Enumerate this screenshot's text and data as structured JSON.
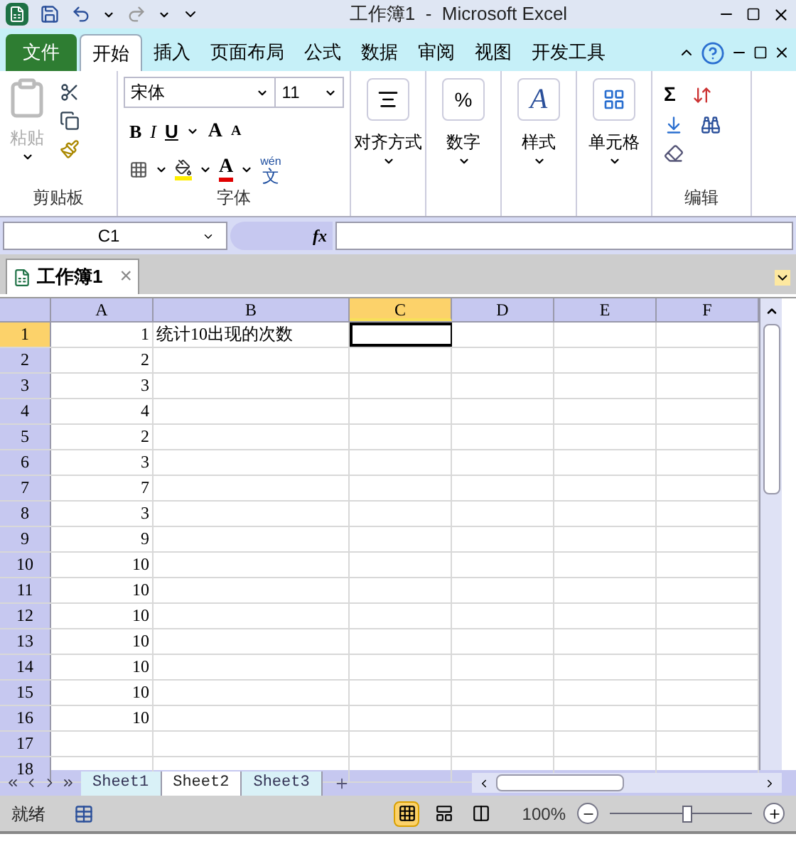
{
  "window": {
    "title": "工作簿1  -  Microsoft Excel"
  },
  "ribbon_tabs": [
    {
      "label": "文件",
      "kind": "file",
      "selected": false
    },
    {
      "label": "开始",
      "kind": "tab",
      "selected": true
    },
    {
      "label": "插入",
      "kind": "tab",
      "selected": false
    },
    {
      "label": "页面布局",
      "kind": "tab",
      "selected": false
    },
    {
      "label": "公式",
      "kind": "tab",
      "selected": false
    },
    {
      "label": "数据",
      "kind": "tab",
      "selected": false
    },
    {
      "label": "审阅",
      "kind": "tab",
      "selected": false
    },
    {
      "label": "视图",
      "kind": "tab",
      "selected": false
    },
    {
      "label": "开发工具",
      "kind": "tab",
      "selected": false
    }
  ],
  "clipboard": {
    "paste": "粘贴",
    "group": "剪贴板"
  },
  "font": {
    "name": "宋体",
    "size": "11",
    "bold": "B",
    "italic": "I",
    "underline": "U",
    "grow": "A",
    "shrink": "A",
    "font_color": "A",
    "phonetic_top": "wén",
    "phonetic_bottom": "文",
    "group": "字体"
  },
  "big_buttons": [
    {
      "label": "对齐方式",
      "kind": "align"
    },
    {
      "label": "数字",
      "kind": "number",
      "glyph": "%"
    },
    {
      "label": "样式",
      "kind": "styles",
      "glyph": "A"
    },
    {
      "label": "单元格",
      "kind": "cells"
    }
  ],
  "editing": {
    "sum": "Σ",
    "group": "编辑"
  },
  "formula_bar": {
    "name_box": "C1",
    "fx": "fx"
  },
  "workbook_tab": {
    "title": "工作簿1",
    "close": "×"
  },
  "columns": [
    {
      "label": "A",
      "selected": false
    },
    {
      "label": "B",
      "selected": false
    },
    {
      "label": "C",
      "selected": true
    },
    {
      "label": "D",
      "selected": false
    },
    {
      "label": "E",
      "selected": false
    },
    {
      "label": "F",
      "selected": false
    }
  ],
  "rows": [
    {
      "label": "1",
      "selected": true,
      "cells": [
        "1",
        "统计10出现的次数"
      ]
    },
    {
      "label": "2",
      "selected": false,
      "cells": [
        "2"
      ]
    },
    {
      "label": "3",
      "selected": false,
      "cells": [
        "3"
      ]
    },
    {
      "label": "4",
      "selected": false,
      "cells": [
        "4"
      ]
    },
    {
      "label": "5",
      "selected": false,
      "cells": [
        "2"
      ]
    },
    {
      "label": "6",
      "selected": false,
      "cells": [
        "3"
      ]
    },
    {
      "label": "7",
      "selected": false,
      "cells": [
        "7"
      ]
    },
    {
      "label": "8",
      "selected": false,
      "cells": [
        "3"
      ]
    },
    {
      "label": "9",
      "selected": false,
      "cells": [
        "9"
      ]
    },
    {
      "label": "10",
      "selected": false,
      "cells": [
        "10"
      ]
    },
    {
      "label": "11",
      "selected": false,
      "cells": [
        "10"
      ]
    },
    {
      "label": "12",
      "selected": false,
      "cells": [
        "10"
      ]
    },
    {
      "label": "13",
      "selected": false,
      "cells": [
        "10"
      ]
    },
    {
      "label": "14",
      "selected": false,
      "cells": [
        "10"
      ]
    },
    {
      "label": "15",
      "selected": false,
      "cells": [
        "10"
      ]
    },
    {
      "label": "16",
      "selected": false,
      "cells": [
        "10"
      ]
    },
    {
      "label": "17",
      "selected": false,
      "cells": []
    },
    {
      "label": "18",
      "selected": false,
      "cells": []
    }
  ],
  "sheet_tabs": [
    {
      "label": "Sheet1",
      "selected": false
    },
    {
      "label": "Sheet2",
      "selected": true
    },
    {
      "label": "Sheet3",
      "selected": false
    }
  ],
  "status_bar": {
    "ready": "就绪",
    "views": [
      {
        "kind": "normal",
        "selected": true
      },
      {
        "kind": "layout",
        "selected": false
      },
      {
        "kind": "pagebreak",
        "selected": false
      }
    ],
    "zoom": "100%",
    "zoom_slider": {
      "level": 0.55
    }
  }
}
